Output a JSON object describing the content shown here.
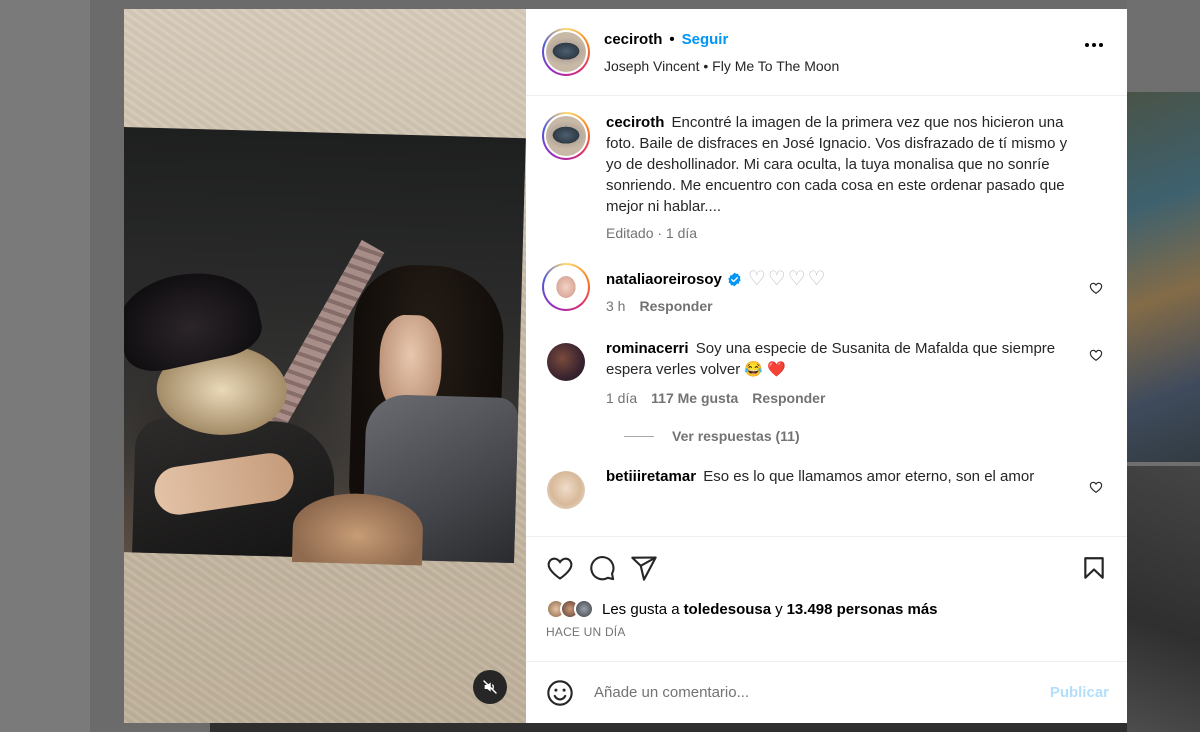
{
  "post": {
    "author": "ceciroth",
    "separator": "•",
    "follow_label": "Seguir",
    "audio": "Joseph Vincent • Fly Me To The Moon",
    "caption_user": "ceciroth",
    "caption": "Encontré la imagen de la primera vez que nos hicieron una foto. Baile de disfraces en José Ignacio. Vos disfrazado de tí mismo y yo de deshollinador. Mi cara oculta, la tuya monalisa que no sonríe sonriendo. Me encuentro con cada cosa en este ordenar pasado que mejor ni hablar....",
    "caption_meta": "Editado · 1 día"
  },
  "comments": [
    {
      "user": "nataliaoreirosoy",
      "verified": true,
      "text": "♡♡♡♡",
      "time": "3 h",
      "reply_label": "Responder"
    },
    {
      "user": "rominacerri",
      "text": "Soy una especie de Susanita de Mafalda que siempre espera verles volver 😂 ❤️",
      "time": "1 día",
      "likes": "117 Me gusta",
      "reply_label": "Responder",
      "view_replies": "Ver respuestas (11)"
    },
    {
      "user": "betiiiretamar",
      "text": "Eso es lo que llamamos amor eterno, son el amor"
    }
  ],
  "actions": {
    "liked_by_prefix": "Les gusta a ",
    "liked_by_user": "toledesousa",
    "liked_by_mid": " y ",
    "liked_by_count": "13.498 personas más",
    "date": "HACE UN DÍA"
  },
  "composer": {
    "placeholder": "Añade un comentario...",
    "publish_label": "Publicar"
  },
  "icons": [
    "mute-icon",
    "more-icon",
    "verified-icon",
    "heart-icon",
    "comment-icon",
    "share-icon",
    "save-icon",
    "emoji-icon"
  ],
  "colors": {
    "link": "#0095f6",
    "publish_disabled": "#b2dffc",
    "verified": "#0095f6",
    "heart_emoji": "#e0245e"
  }
}
